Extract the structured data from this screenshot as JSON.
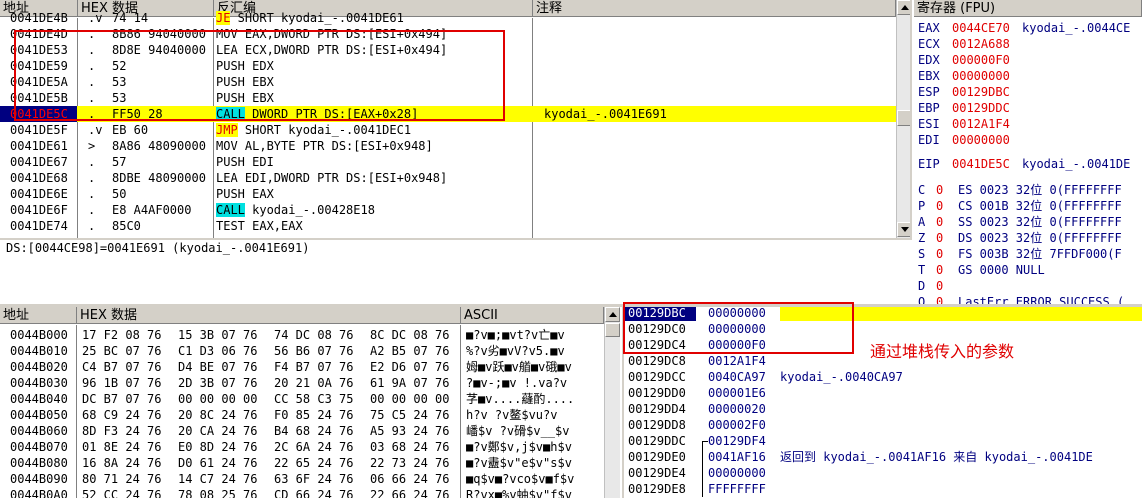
{
  "disasm": {
    "headers": {
      "addr": "地址",
      "hex": "HEX 数据",
      "asm": "反汇编",
      "comment": "注释"
    },
    "rows": [
      {
        "addr": "0041DE4B",
        "mark": ".v",
        "hex": "74 14",
        "asm": "JE SHORT kyodai_-.0041DE61",
        "comment": "",
        "je": "JE"
      },
      {
        "addr": "0041DE4D",
        "mark": ".",
        "hex": "8B86 94040000",
        "asm": "MOV EAX,DWORD PTR DS:[ESI+0x494]",
        "comment": ""
      },
      {
        "addr": "0041DE53",
        "mark": ".",
        "hex": "8D8E 94040000",
        "asm": "LEA ECX,DWORD PTR DS:[ESI+0x494]",
        "comment": ""
      },
      {
        "addr": "0041DE59",
        "mark": ".",
        "hex": "52",
        "asm": "PUSH EDX",
        "comment": ""
      },
      {
        "addr": "0041DE5A",
        "mark": ".",
        "hex": "53",
        "asm": "PUSH EBX",
        "comment": ""
      },
      {
        "addr": "0041DE5B",
        "mark": ".",
        "hex": "53",
        "asm": "PUSH EBX",
        "comment": ""
      },
      {
        "addr": "0041DE5C",
        "mark": ".",
        "hex": "FF50 28",
        "asm_kw": "CALL",
        "asm": " DWORD PTR DS:[EAX+0x28]",
        "comment": "kyodai_-.0041E691"
      },
      {
        "addr": "0041DE5F",
        "mark": ".v",
        "hex": "EB 60",
        "asm_kw": "JMP",
        "asm": " SHORT kyodai_-.0041DEC1",
        "comment": ""
      },
      {
        "addr": "0041DE61",
        "mark": ">",
        "hex": "8A86 48090000",
        "asm": "MOV AL,BYTE PTR DS:[ESI+0x948]",
        "comment": ""
      },
      {
        "addr": "0041DE67",
        "mark": ".",
        "hex": "57",
        "asm": "PUSH EDI",
        "comment": ""
      },
      {
        "addr": "0041DE68",
        "mark": ".",
        "hex": "8DBE 48090000",
        "asm": "LEA EDI,DWORD PTR DS:[ESI+0x948]",
        "comment": ""
      },
      {
        "addr": "0041DE6E",
        "mark": ".",
        "hex": "50",
        "asm": "PUSH EAX",
        "comment": ""
      },
      {
        "addr": "0041DE6F",
        "mark": ".",
        "hex": "E8 A4AF0000",
        "asm_kw": "CALL",
        "asm": " kyodai_-.00428E18",
        "comment": ""
      },
      {
        "addr": "0041DE74",
        "mark": ".",
        "hex": "85C0",
        "asm": "TEST EAX,EAX",
        "comment": ""
      }
    ],
    "info_line": "DS:[0044CE98]=0041E691 (kyodai_-.0041E691)"
  },
  "registers": {
    "header": "寄存器 (FPU)",
    "regs": [
      {
        "name": "EAX",
        "value": "0044CE70",
        "note": "kyodai_-.0044CE"
      },
      {
        "name": "ECX",
        "value": "0012A688",
        "note": ""
      },
      {
        "name": "EDX",
        "value": "000000F0",
        "note": ""
      },
      {
        "name": "EBX",
        "value": "00000000",
        "note": ""
      },
      {
        "name": "ESP",
        "value": "00129DBC",
        "note": ""
      },
      {
        "name": "EBP",
        "value": "00129DDC",
        "note": ""
      },
      {
        "name": "ESI",
        "value": "0012A1F4",
        "note": ""
      },
      {
        "name": "EDI",
        "value": "00000000",
        "note": ""
      }
    ],
    "eip": {
      "name": "EIP",
      "value": "0041DE5C",
      "note": "kyodai_-.0041DE"
    },
    "flags": [
      {
        "f": "C",
        "v": "0",
        "seg": "ES 0023 32位 0(FFFFFFFF"
      },
      {
        "f": "P",
        "v": "0",
        "seg": "CS 001B 32位 0(FFFFFFFF"
      },
      {
        "f": "A",
        "v": "0",
        "seg": "SS 0023 32位 0(FFFFFFFF"
      },
      {
        "f": "Z",
        "v": "0",
        "seg": "DS 0023 32位 0(FFFFFFFF"
      },
      {
        "f": "S",
        "v": "0",
        "seg": "FS 003B 32位 7FFDF000(F"
      },
      {
        "f": "T",
        "v": "0",
        "seg": "GS 0000 NULL"
      },
      {
        "f": "D",
        "v": "0",
        "seg": ""
      },
      {
        "f": "O",
        "v": "0",
        "seg": "LastErr ERROR_SUCCESS ("
      }
    ]
  },
  "dump": {
    "headers": {
      "addr": "地址",
      "hex": "HEX 数据",
      "ascii": "ASCII"
    },
    "rows": [
      {
        "addr": "0044B000",
        "h1": "17 F2 08 76",
        "h2": "15 3B 07 76",
        "h3": "74 DC 08 76",
        "h4": "8C DC 08 76",
        "ascii": "■?v■;■vt?v亡■v"
      },
      {
        "addr": "0044B010",
        "h1": "25 BC 07 76",
        "h2": "C1 D3 06 76",
        "h3": "56 B6 07 76",
        "h4": "A2 B5 07 76",
        "ascii": "%?v劣■vV?v5.■v"
      },
      {
        "addr": "0044B020",
        "h1": "C4 B7 07 76",
        "h2": "D4 BE 07 76",
        "h3": "F4 B7 07 76",
        "h4": "E2 D6 07 76",
        "ascii": "姆■v跃■v艏■v硪■v"
      },
      {
        "addr": "0044B030",
        "h1": "96 1B 07 76",
        "h2": "2D 3B 07 76",
        "h3": "20 21 0A 76",
        "h4": "61 9A 07 76",
        "ascii": "?■v-;■v !.va?v"
      },
      {
        "addr": "0044B040",
        "h1": "DC B7 07 76",
        "h2": "00 00 00 00",
        "h3": "CC 58 C3 75",
        "h4": "00 00 00 00",
        "ascii": "芓■v....蘕酌...."
      },
      {
        "addr": "0044B050",
        "h1": "68 C9 24 76",
        "h2": "20 8C 24 76",
        "h3": "F0 85 24 76",
        "h4": "75 C5 24 76",
        "ascii": "h?v ?v鳌$vu?v"
      },
      {
        "addr": "0044B060",
        "h1": "8D F3 24 76",
        "h2": "20 CA 24 76",
        "h3": "B4 68 24 76",
        "h4": "A5 93 24 76",
        "ascii": "嶓$v ?v磆$v__$v"
      },
      {
        "addr": "0044B070",
        "h1": "01 8E 24 76",
        "h2": "E0 8D 24 76",
        "h3": "2C 6A 24 76",
        "h4": "03 68 24 76",
        "ascii": "■?v鄭$v,j$v■h$v"
      },
      {
        "addr": "0044B080",
        "h1": "16 8A 24 76",
        "h2": "D0 61 24 76",
        "h3": "22 65 24 76",
        "h4": "22 73 24 76",
        "ascii": "■?v衋$v\"e$v\"s$v"
      },
      {
        "addr": "0044B090",
        "h1": "80 71 24 76",
        "h2": "14 C7 24 76",
        "h3": "63 6F 24 76",
        "h4": "06 66 24 76",
        "ascii": "■q$v■?vco$v■f$v"
      },
      {
        "addr": "0044B0A0",
        "h1": "52 CC 24 76",
        "h2": "78 08 25 76",
        "h3": "CD 66 24 76",
        "h4": "22 66 24 76",
        "ascii": "R?vx■%v蚰$v\"f$v"
      }
    ]
  },
  "stack": {
    "rows": [
      {
        "addr": "00129DBC",
        "value": "00000000",
        "note": "",
        "bracket": ""
      },
      {
        "addr": "00129DC0",
        "value": "00000000",
        "note": "",
        "bracket": ""
      },
      {
        "addr": "00129DC4",
        "value": "000000F0",
        "note": "",
        "bracket": ""
      },
      {
        "addr": "00129DC8",
        "value": "0012A1F4",
        "note": "",
        "bracket": ""
      },
      {
        "addr": "00129DCC",
        "value": "0040CA97",
        "note": "kyodai_-.0040CA97",
        "bracket": ""
      },
      {
        "addr": "00129DD0",
        "value": "000001E6",
        "note": "",
        "bracket": ""
      },
      {
        "addr": "00129DD4",
        "value": "00000020",
        "note": "",
        "bracket": ""
      },
      {
        "addr": "00129DD8",
        "value": "000002F0",
        "note": "",
        "bracket": ""
      },
      {
        "addr": "00129DDC",
        "value": "00129DF4",
        "note": "",
        "bracket": "top"
      },
      {
        "addr": "00129DE0",
        "value": "0041AF16",
        "note": "返回到 kyodai_-.0041AF16 来自 kyodai_-.0041DE",
        "bracket": "mid"
      },
      {
        "addr": "00129DE4",
        "value": "00000000",
        "note": "",
        "bracket": "mid"
      },
      {
        "addr": "00129DE8",
        "value": "FFFFFFFF",
        "note": "",
        "bracket": "mid"
      }
    ]
  },
  "annotation": {
    "text": "通过堆栈传入的参数"
  },
  "colors": {
    "highlight": "#ffff00",
    "selection": "#000080",
    "accent_red": "#e00000",
    "call_cyan": "#00e0e0"
  }
}
